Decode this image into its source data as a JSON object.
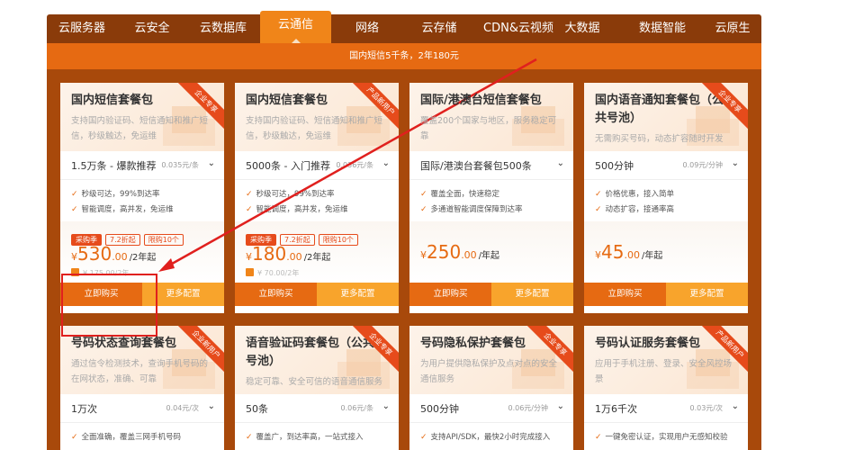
{
  "nav": {
    "tabs": [
      {
        "label": "云服务器"
      },
      {
        "label": "云安全"
      },
      {
        "label": "云数据库"
      },
      {
        "label": "云通信"
      },
      {
        "label": "网络"
      },
      {
        "label": "云存储"
      },
      {
        "label": "CDN&云视频"
      },
      {
        "label": "大数据"
      },
      {
        "label": "数据智能"
      },
      {
        "label": "云原生"
      }
    ],
    "active_index": 3
  },
  "banner": {
    "text": "国内短信5千条，2年180元"
  },
  "colors": {
    "brand": "#e66a12",
    "dark": "#8a3b0a",
    "ribbon": "#e64b1b",
    "config": "#f8a42c",
    "annotation": "#e0201e"
  },
  "cards": [
    {
      "title": "国内短信套餐包",
      "ribbon": "企业专享",
      "desc": "支持国内验证码、短信通知和推广短信，秒级触达，免运维",
      "spec": "1.5万条 - 爆款推荐",
      "spec_price": "0.035元/条",
      "features": [
        "秒级可达，99%到达率",
        "智能调度，高并发，免运维"
      ],
      "tags": [
        "采购季",
        "7.2折起",
        "限购10个"
      ],
      "price_int": "530",
      "price_dec": ".00",
      "price_unit": "/2年起",
      "orig": "¥ 175.00/2年",
      "buy": "立即购买",
      "config": "更多配置"
    },
    {
      "title": "国内短信套餐包",
      "ribbon": "产品新用户",
      "desc": "支持国内验证码、短信通知和推广短信，秒级触达，免运维",
      "spec": "5000条 - 入门推荐",
      "spec_price": "0.036元/条",
      "features": [
        "秒级可达，99%到达率",
        "智能调度，高并发，免运维"
      ],
      "tags": [
        "采购季",
        "7.2折起",
        "限购10个"
      ],
      "price_int": "180",
      "price_dec": ".00",
      "price_unit": "/2年起",
      "orig": "¥ 70.00/2年",
      "buy": "立即购买",
      "config": "更多配置"
    },
    {
      "title": "国际/港澳台短信套餐包",
      "ribbon": "",
      "desc": "覆盖200个国家与地区，服务稳定可靠",
      "spec": "国际/港澳台套餐包500条",
      "spec_price": "",
      "features": [
        "覆盖全面，快速稳定",
        "多通道智能调度保障到达率"
      ],
      "tags": [],
      "price_int": "250",
      "price_dec": ".00",
      "price_unit": "/年起",
      "orig": "",
      "buy": "立即购买",
      "config": "更多配置"
    },
    {
      "title": "国内语音通知套餐包（公共号池）",
      "ribbon": "企业专享",
      "desc": "无需购买号码，动态扩容随时开发",
      "spec": "500分钟",
      "spec_price": "0.09元/分钟",
      "features": [
        "价格优惠，接入简单",
        "动态扩容，接通率高"
      ],
      "tags": [],
      "price_int": "45",
      "price_dec": ".00",
      "price_unit": "/年起",
      "orig": "",
      "buy": "立即购买",
      "config": "更多配置"
    },
    {
      "title": "号码状态查询套餐包",
      "ribbon": "企业新用户",
      "desc": "通过信令检测技术，查询手机号码的在网状态，准确、可靠",
      "spec": "1万次",
      "spec_price": "0.04元/次",
      "features": [
        "全面准确，覆盖三网手机号码"
      ]
    },
    {
      "title": "语音验证码套餐包（公共号池）",
      "ribbon": "企业专享",
      "desc": "稳定可靠、安全可信的语音通信服务",
      "spec": "50条",
      "spec_price": "0.06元/条",
      "features": [
        "覆盖广，到达率高，一站式接入"
      ]
    },
    {
      "title": "号码隐私保护套餐包",
      "ribbon": "企业专享",
      "desc": "为用户提供隐私保护及点对点的安全通信服务",
      "spec": "500分钟",
      "spec_price": "0.06元/分钟",
      "features": [
        "支持API/SDK，最快2小时完成接入"
      ]
    },
    {
      "title": "号码认证服务套餐包",
      "ribbon": "产品新用户",
      "desc": "应用于手机注册、登录、安全风控场景",
      "spec": "1万6千次",
      "spec_price": "0.03元/次",
      "features": [
        "一键免密认证，实现用户无感知校验"
      ]
    }
  ]
}
